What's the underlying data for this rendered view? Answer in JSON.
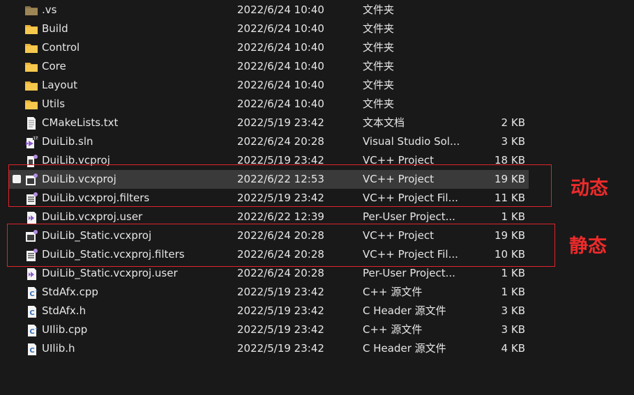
{
  "accent_color": "#e0232b",
  "files": [
    {
      "name": ".vs",
      "date": "2022/6/24 10:40",
      "type": "文件夹",
      "size": "",
      "icon": "folder-dim-icon"
    },
    {
      "name": "Build",
      "date": "2022/6/24 10:40",
      "type": "文件夹",
      "size": "",
      "icon": "folder-icon"
    },
    {
      "name": "Control",
      "date": "2022/6/24 10:40",
      "type": "文件夹",
      "size": "",
      "icon": "folder-icon"
    },
    {
      "name": "Core",
      "date": "2022/6/24 10:40",
      "type": "文件夹",
      "size": "",
      "icon": "folder-icon"
    },
    {
      "name": "Layout",
      "date": "2022/6/24 10:40",
      "type": "文件夹",
      "size": "",
      "icon": "folder-icon"
    },
    {
      "name": "Utils",
      "date": "2022/6/24 10:40",
      "type": "文件夹",
      "size": "",
      "icon": "folder-icon"
    },
    {
      "name": "CMakeLists.txt",
      "date": "2022/5/19 23:42",
      "type": "文本文档",
      "size": "2 KB",
      "icon": "text-file-icon"
    },
    {
      "name": "DuiLib.sln",
      "date": "2022/6/24 20:28",
      "type": "Visual Studio Sol...",
      "size": "3 KB",
      "icon": "vs-solution-icon"
    },
    {
      "name": "DuiLib.vcproj",
      "date": "2022/5/19 23:42",
      "type": "VC++ Project",
      "size": "18 KB",
      "icon": "vcproj-icon"
    },
    {
      "name": "DuiLib.vcxproj",
      "date": "2022/6/22 12:53",
      "type": "VC++ Project",
      "size": "19 KB",
      "icon": "vcxproj-icon"
    },
    {
      "name": "DuiLib.vcxproj.filters",
      "date": "2022/5/19 23:42",
      "type": "VC++ Project Fil...",
      "size": "11 KB",
      "icon": "filters-file-icon"
    },
    {
      "name": "DuiLib.vcxproj.user",
      "date": "2022/6/22 12:39",
      "type": "Per-User Project...",
      "size": "1 KB",
      "icon": "user-file-icon"
    },
    {
      "name": "DuiLib_Static.vcxproj",
      "date": "2022/6/24 20:28",
      "type": "VC++ Project",
      "size": "19 KB",
      "icon": "vcxproj-icon"
    },
    {
      "name": "DuiLib_Static.vcxproj.filters",
      "date": "2022/6/24 20:28",
      "type": "VC++ Project Fil...",
      "size": "10 KB",
      "icon": "filters-file-icon"
    },
    {
      "name": "DuiLib_Static.vcxproj.user",
      "date": "2022/6/24 20:28",
      "type": "Per-User Project...",
      "size": "1 KB",
      "icon": "user-file-icon"
    },
    {
      "name": "StdAfx.cpp",
      "date": "2022/5/19 23:42",
      "type": "C++ 源文件",
      "size": "1 KB",
      "icon": "cpp-file-icon"
    },
    {
      "name": "StdAfx.h",
      "date": "2022/5/19 23:42",
      "type": "C Header 源文件",
      "size": "3 KB",
      "icon": "header-file-icon"
    },
    {
      "name": "UIlib.cpp",
      "date": "2022/5/19 23:42",
      "type": "C++ 源文件",
      "size": "3 KB",
      "icon": "cpp-file-icon"
    },
    {
      "name": "UIlib.h",
      "date": "2022/5/19 23:42",
      "type": "C Header 源文件",
      "size": "4 KB",
      "icon": "header-file-icon"
    }
  ],
  "selected_index": 9,
  "annotations": {
    "dynamic_label": "动态",
    "static_label": "静态"
  }
}
